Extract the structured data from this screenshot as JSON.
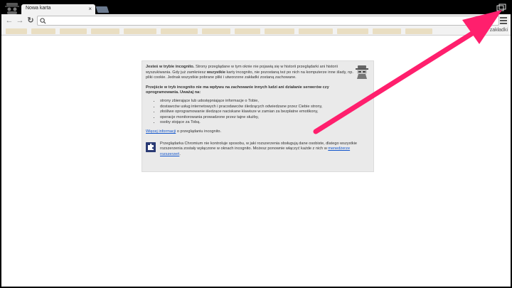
{
  "browser": {
    "tab": {
      "title": "Nowa karta",
      "close_glyph": "×"
    },
    "omnibox": {
      "value": ""
    },
    "bookmarks": {
      "other_label": "Inne zakładki"
    }
  },
  "incognito": {
    "p1_bold": "Jesteś w trybie incognito.",
    "p1_a": " Strony przeglądane w tym oknie nie pojawią się w historii przeglądarki ani historii wyszukiwania. Gdy już zamkniesz ",
    "p1_bold2": "wszystkie",
    "p1_b": " karty incognito, nie pozostaną też po nich na komputerze inne ślady, np. pliki cookie. Jednak wszystkie pobrane pliki i utworzone zakładki zostaną zachowane.",
    "p2": "Przejście w tryb incognito nie ma wpływu na zachowanie innych ludzi ani działanie serwerów czy oprogramowania. Uważaj na:",
    "bullets": [
      "strony zbierające lub udostępniające informacje o Tobie,",
      "dostawców usług internetowych i pracodawców śledzących odwiedzane przez Ciebie strony,",
      "złośliwe oprogramowanie śledzące naciskane klawisze w zamian za bezpłatne emotikony,",
      "operacje monitorowania prowadzone przez tajne służby,",
      "osoby stojące za Tobą."
    ],
    "more_link": "Więcej informacji",
    "more_rest": " o przeglądaniu incognito.",
    "ext_text": "Przeglądarka Chromium nie kontroluje sposobu, w jaki rozszerzenia obsługują dane osobiste, dlatego wszystkie rozszerzenia zostały wyłączone w oknach incognito. Możesz ponownie włączyć każde z nich w ",
    "ext_link": "menedżerze rozszerzeń",
    "ext_end": "."
  },
  "colors": {
    "arrow": "#ff1f6d",
    "link": "#1155cc"
  },
  "icons": [
    "incognito-avatar-icon",
    "back-icon",
    "forward-icon",
    "reload-icon",
    "search-icon",
    "star-icon",
    "menu-icon",
    "restore-window-icon",
    "puzzle-icon",
    "spy-icon"
  ]
}
